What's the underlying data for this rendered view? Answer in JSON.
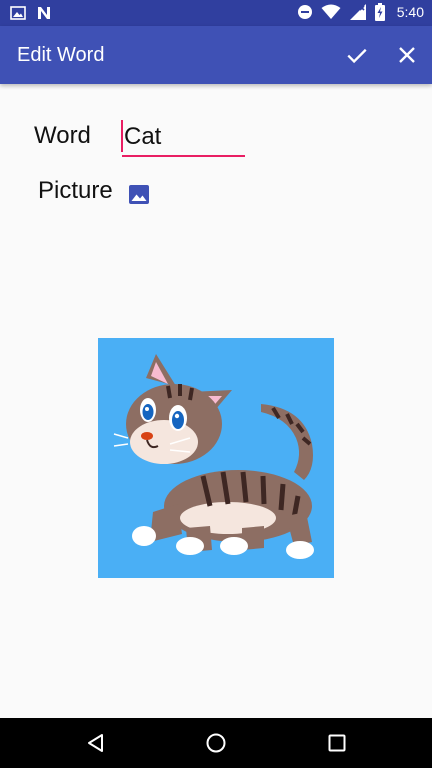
{
  "status_bar": {
    "time": "5:40",
    "icons": [
      "image-notification-icon",
      "n-notification-icon",
      "do-not-disturb-icon",
      "wifi-icon",
      "no-signal-icon",
      "battery-charging-icon"
    ]
  },
  "app_bar": {
    "title": "Edit Word",
    "actions": [
      "check-icon",
      "close-icon"
    ]
  },
  "form": {
    "word_label": "Word",
    "word_value": "Cat",
    "picture_label": "Picture",
    "picture_button_icon": "image-icon"
  },
  "colors": {
    "status_bar": "#303f9f",
    "app_bar": "#3f51b5",
    "accent": "#e91e63",
    "picture_background": "#4aaff5"
  },
  "nav_bar": {
    "icons": [
      "back-icon",
      "home-icon",
      "recents-icon"
    ]
  }
}
